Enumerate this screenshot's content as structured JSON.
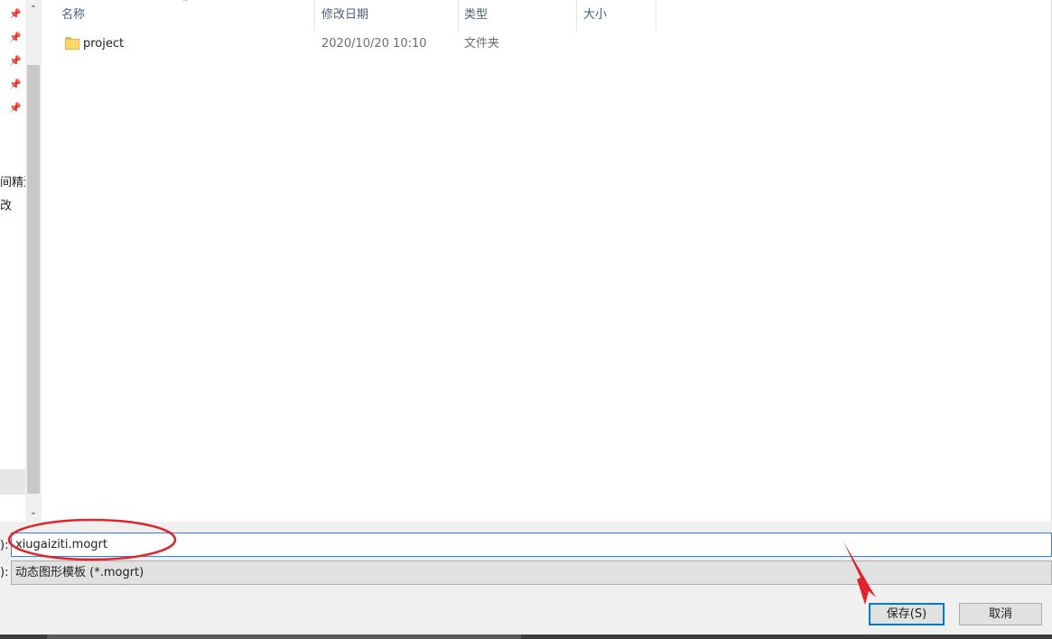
{
  "nav": {
    "partial_labels": [
      "间精江",
      "改"
    ],
    "pins": [
      "pin-icon",
      "pin-icon",
      "pin-icon",
      "pin-icon",
      "pin-icon"
    ]
  },
  "columns": {
    "name": "名称",
    "date": "修改日期",
    "type": "类型",
    "size": "大小"
  },
  "files": [
    {
      "name": "project",
      "date": "2020/10/20 10:10",
      "type": "文件夹",
      "size": "",
      "icon": "folder-icon"
    }
  ],
  "save_form": {
    "filename_label": "):",
    "filename_value": "xiugaiziti.mogrt",
    "filetype_label": "):",
    "filetype_value": "动态图形模板 (*.mogrt)"
  },
  "buttons": {
    "save": "保存(S)",
    "cancel": "取消"
  },
  "annotation_colors": {
    "circle": "#e0242b",
    "arrow": "#e0242b"
  }
}
